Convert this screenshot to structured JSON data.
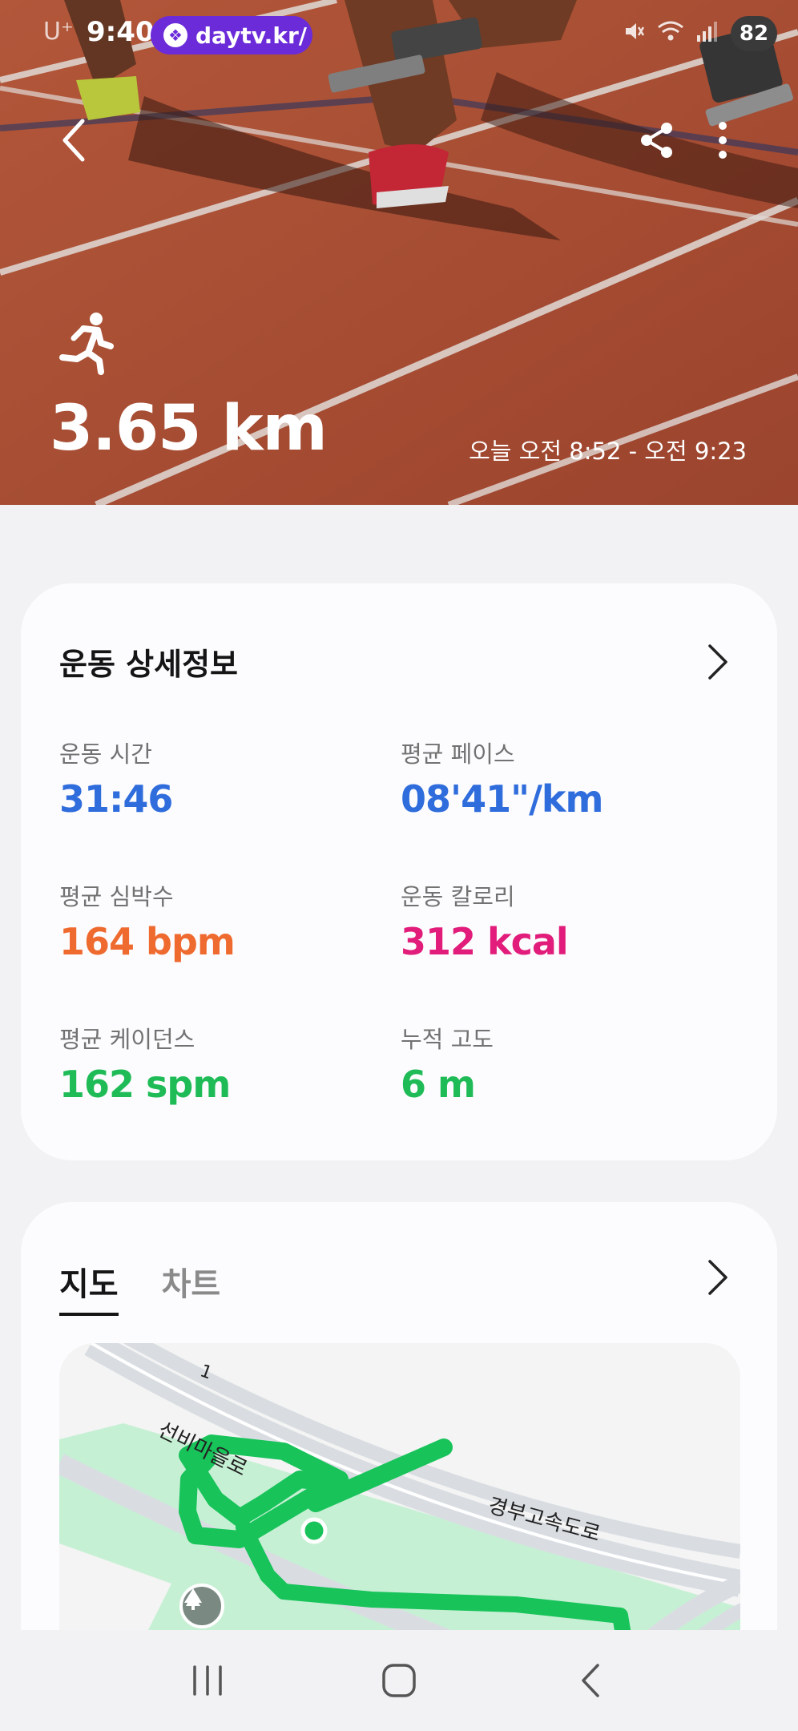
{
  "status_bar": {
    "carrier": "U⁺",
    "time": "9:40",
    "notification_url": "daytv.kr/",
    "battery": "82"
  },
  "hero": {
    "distance": "3.65 km",
    "time_range": "오늘 오전 8:52 - 오전 9:23"
  },
  "details": {
    "title": "운동 상세정보",
    "stats": [
      {
        "label": "운동 시간",
        "value": "31:46",
        "color": "#2f6cdc"
      },
      {
        "label": "평균 페이스",
        "value": "08'41\"/km",
        "color": "#2f6cdc"
      },
      {
        "label": "평균 심박수",
        "value": "164 bpm",
        "color": "#ef6a2f"
      },
      {
        "label": "운동 칼로리",
        "value": "312 kcal",
        "color": "#e11c7a"
      },
      {
        "label": "평균 케이던스",
        "value": "162 spm",
        "color": "#1fbb57"
      },
      {
        "label": "누적 고도",
        "value": "6 m",
        "color": "#1fbb57"
      }
    ]
  },
  "map_card": {
    "tabs": [
      {
        "label": "지도",
        "active": true
      },
      {
        "label": "차트",
        "active": false
      }
    ],
    "map_labels": {
      "road_number": "1",
      "expressway": "경부고속도로",
      "street": "선비마을로"
    },
    "route_color": "#18c35a"
  },
  "icons": {
    "back": "chevron-left-icon",
    "share": "share-icon",
    "more": "more-vertical-icon",
    "activity": "running-icon",
    "park": "tree-icon",
    "nav_recents": "recents-icon",
    "nav_home": "home-icon",
    "nav_back": "back-icon"
  }
}
